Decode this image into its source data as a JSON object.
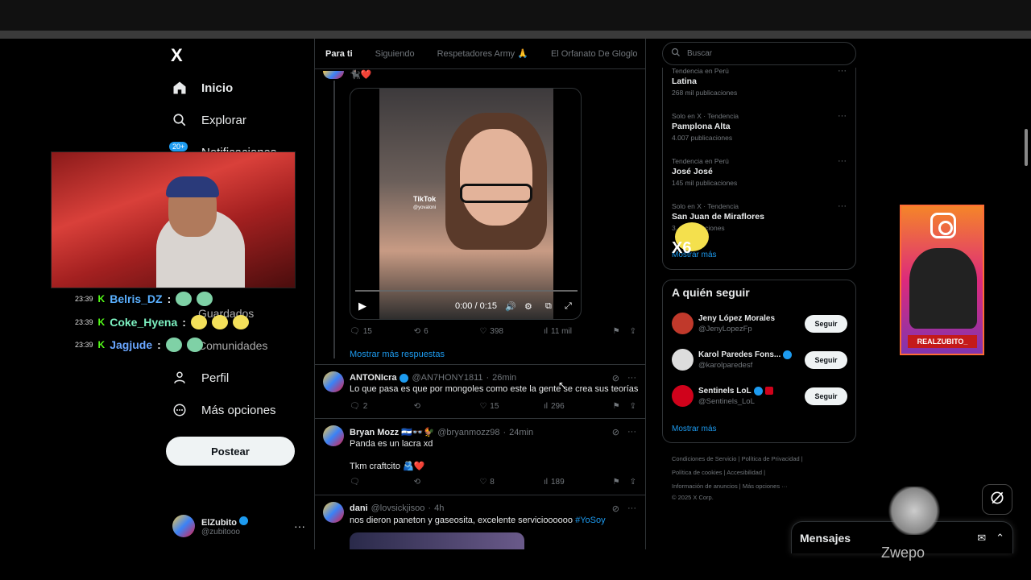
{
  "nav": {
    "logo": "X",
    "items": [
      {
        "label": "Inicio"
      },
      {
        "label": "Explorar"
      },
      {
        "label": "Notificaciones"
      },
      {
        "label": "Guardados"
      },
      {
        "label": "Comunidades"
      },
      {
        "label": "Perfil"
      },
      {
        "label": "Más opciones"
      }
    ],
    "notif_badge": "20+",
    "post_label": "Postear"
  },
  "profile": {
    "name": "ElZubito",
    "handle": "@zubitooo"
  },
  "chat": [
    {
      "time": "23:39",
      "user": "Belris_DZ",
      "color": "#5ab0ff"
    },
    {
      "time": "23:39",
      "user": "Coke_Hyena",
      "color": "#7cf0c0"
    },
    {
      "time": "23:39",
      "user": "Jagjude",
      "color": "#6aa6ff"
    }
  ],
  "tabs": [
    "Para ti",
    "Siguiendo",
    "Respetadores Army 🙏",
    "El Orfanato De Gloglo"
  ],
  "video": {
    "watermark": "TikTok",
    "watermark_handle": "@yovaloni",
    "time": "0:00 / 0:15",
    "reply_emoji": "🐈‍⬛❤️",
    "actions": {
      "replies": "15",
      "retweets": "6",
      "likes": "398",
      "views": "11 mil"
    }
  },
  "show_more_replies": "Mostrar más respuestas",
  "tweets": [
    {
      "name": "ANTONIcra",
      "handle": "@AN7HONY1811",
      "time": "26min",
      "text": "Lo que pasa es que por mongoles como este la gente se crea sus teorías",
      "actions": {
        "replies": "2",
        "retweets": "",
        "likes": "15",
        "views": "296"
      }
    },
    {
      "name": "Bryan Mozz 🇸🇻👓🐓",
      "handle": "@bryanmozz98",
      "time": "24min",
      "text": "Panda es un lacra xd",
      "text2": "Tkm craftcito 🫂❤️",
      "actions": {
        "replies": "",
        "retweets": "",
        "likes": "8",
        "views": "189"
      }
    },
    {
      "name": "dani",
      "handle": "@lovsickjisoo",
      "time": "4h",
      "text": "nos dieron paneton y gaseosita, excelente servicioooooo ",
      "hashtag": "#YoSoy"
    }
  ],
  "search": {
    "placeholder": "Buscar"
  },
  "trends": [
    {
      "context": "Tendencia en Perú",
      "name": "Latina",
      "count": "268 mil publicaciones"
    },
    {
      "context": "Solo en X · Tendencia",
      "name": "Pamplona Alta",
      "count": "4.007 publicaciones"
    },
    {
      "context": "Tendencia en Perú",
      "name": "José José",
      "count": "145 mil publicaciones"
    },
    {
      "context": "Solo en X · Tendencia",
      "name": "San Juan de Miraflores",
      "count": "3... publicaciones"
    }
  ],
  "trends_show_more": "Mostrar más",
  "who_to_follow": {
    "title": "A quién seguir",
    "users": [
      {
        "name": "Jeny López Morales",
        "handle": "@JenyLopezFp",
        "button": "Seguir"
      },
      {
        "name": "Karol Paredes Fons...",
        "handle": "@karolparedesf",
        "button": "Seguir"
      },
      {
        "name": "Sentinels LoL",
        "handle": "@Sentinels_LoL",
        "button": "Seguir"
      }
    ],
    "show_more": "Mostrar más"
  },
  "footer": {
    "line1": "Condiciones de Servicio  |  Política de Privacidad  |",
    "line2": "Política de cookies  |  Accesibilidad  |",
    "line3": "Información de anuncios  |  Más opciones ···",
    "line4": "© 2025 X Corp."
  },
  "messages": {
    "title": "Mensajes"
  },
  "overlay": {
    "instagram_tag": "REALZUBITO_",
    "zwepo": "Zwepo",
    "multiplier": "X6"
  },
  "colors": {
    "accent": "#1d9bf0",
    "kick": "#53fc18",
    "background": "#000000"
  }
}
